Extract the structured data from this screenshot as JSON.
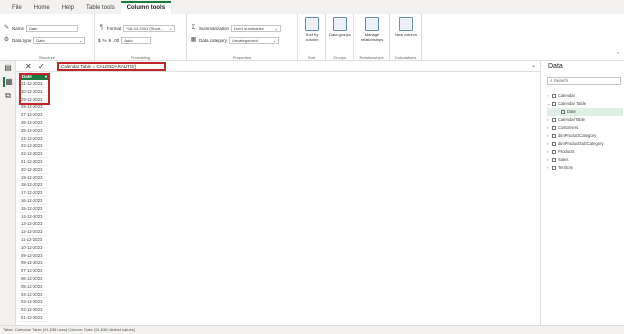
{
  "ribbon_tabs": [
    "File",
    "Home",
    "Help",
    "Table tools",
    "Column tools"
  ],
  "structure": {
    "name_label": "Name",
    "name_value": "Date",
    "datatype_label": "Data type",
    "datatype_value": "Date",
    "group_label": "Structure"
  },
  "formatting": {
    "format_label": "Format",
    "format_value": "*18-03-2001 (Short...",
    "symbols": [
      "$",
      "%",
      "9",
      ".00"
    ],
    "decimals_value": "Auto",
    "group_label": "Formatting"
  },
  "properties": {
    "summarization_label": "Summarization",
    "summarization_value": "Don't summarize",
    "category_label": "Data category",
    "category_value": "Uncategorized",
    "group_label": "Properties"
  },
  "sort": {
    "button_label": "Sort by column",
    "group_label": "Sort"
  },
  "groups": {
    "button_label": "Data groups",
    "group_label": "Groups"
  },
  "relationships": {
    "button_label": "Manage relationships",
    "group_label": "Relationships"
  },
  "calculations": {
    "button_label": "New column",
    "group_label": "Calculations"
  },
  "formula_bar": {
    "text": "Calendar Table = CALENDARAUTO()"
  },
  "table": {
    "column_header": "Date",
    "rows": [
      "31-12-2023",
      "30-12-2023",
      "29-12-2023",
      "28-12-2023",
      "27-12-2023",
      "26-12-2023",
      "25-12-2023",
      "24-12-2023",
      "23-12-2023",
      "22-12-2023",
      "21-12-2023",
      "20-12-2023",
      "19-12-2023",
      "18-12-2023",
      "17-12-2023",
      "16-12-2023",
      "15-12-2023",
      "14-12-2023",
      "13-12-2023",
      "12-12-2023",
      "11-12-2023",
      "10-12-2023",
      "09-12-2023",
      "08-12-2023",
      "07-12-2023",
      "06-12-2023",
      "05-12-2023",
      "04-12-2023",
      "03-12-2023",
      "02-12-2023",
      "01-12-2023"
    ]
  },
  "data_pane": {
    "title": "Data",
    "search_placeholder": "Search",
    "items": [
      {
        "label": "Calendar",
        "level": 0
      },
      {
        "label": "Calendar Table",
        "level": 0
      },
      {
        "label": "Date",
        "level": 1
      },
      {
        "label": "CalendarTable",
        "level": 0
      },
      {
        "label": "Customers",
        "level": 0
      },
      {
        "label": "dimProductCategory",
        "level": 0
      },
      {
        "label": "dimProductSubCategory",
        "level": 0
      },
      {
        "label": "Products",
        "level": 0
      },
      {
        "label": "Sales",
        "level": 0
      },
      {
        "label": "Territory",
        "level": 0
      }
    ]
  },
  "status_bar": "Table: Calendar Table (91,638 rows)  Column: Date (91,638 distinct values)",
  "colors": {
    "accent": "#1e7a3c",
    "highlight": "#c0272d"
  }
}
